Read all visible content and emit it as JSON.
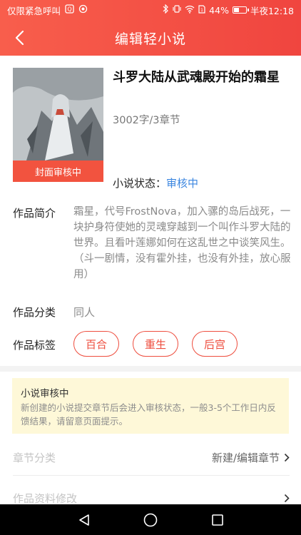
{
  "status_bar": {
    "left_text": "仅限紧急呼叫",
    "battery_text": "44%",
    "battery_level": 0.44,
    "time": "半夜12:18"
  },
  "nav": {
    "title": "编辑轻小说"
  },
  "book": {
    "title": "斗罗大陆从武魂殿开始的霜星",
    "meta": "3002字/3章节",
    "cover_badge": "封面审核中",
    "status_label": "小说状态：",
    "status_value": "审核中",
    "status_color": "#3b86e0"
  },
  "intro": {
    "label": "作品简介",
    "text": "霜星，代号FrostNova，加入骡的岛后战死，一块护身符使她的灵魂穿越到一个叫作斗罗大陆的世界。且看叶莲娜如何在这乱世之中谈笑风生。",
    "text2": "（斗一剧情，没有霍外挂，也没有外挂，放心服用）"
  },
  "category": {
    "label": "作品分类",
    "value": "同人"
  },
  "tags": {
    "label": "作品标签",
    "items": [
      "百合",
      "重生",
      "后宫"
    ]
  },
  "notice": {
    "title": "小说审核中",
    "text": "新创建的小说提交章节后会进入审核状态，一般3-5个工作日内反馈结果，请留意页面提示。"
  },
  "rows": {
    "chapter_label": "章节分类",
    "chapter_action": "新建/编辑章节",
    "info_label": "作品资料修改"
  },
  "colors": {
    "accent": "#f0453f",
    "tag": "#ee4d3e",
    "notice_bg": "#fef8d8"
  }
}
